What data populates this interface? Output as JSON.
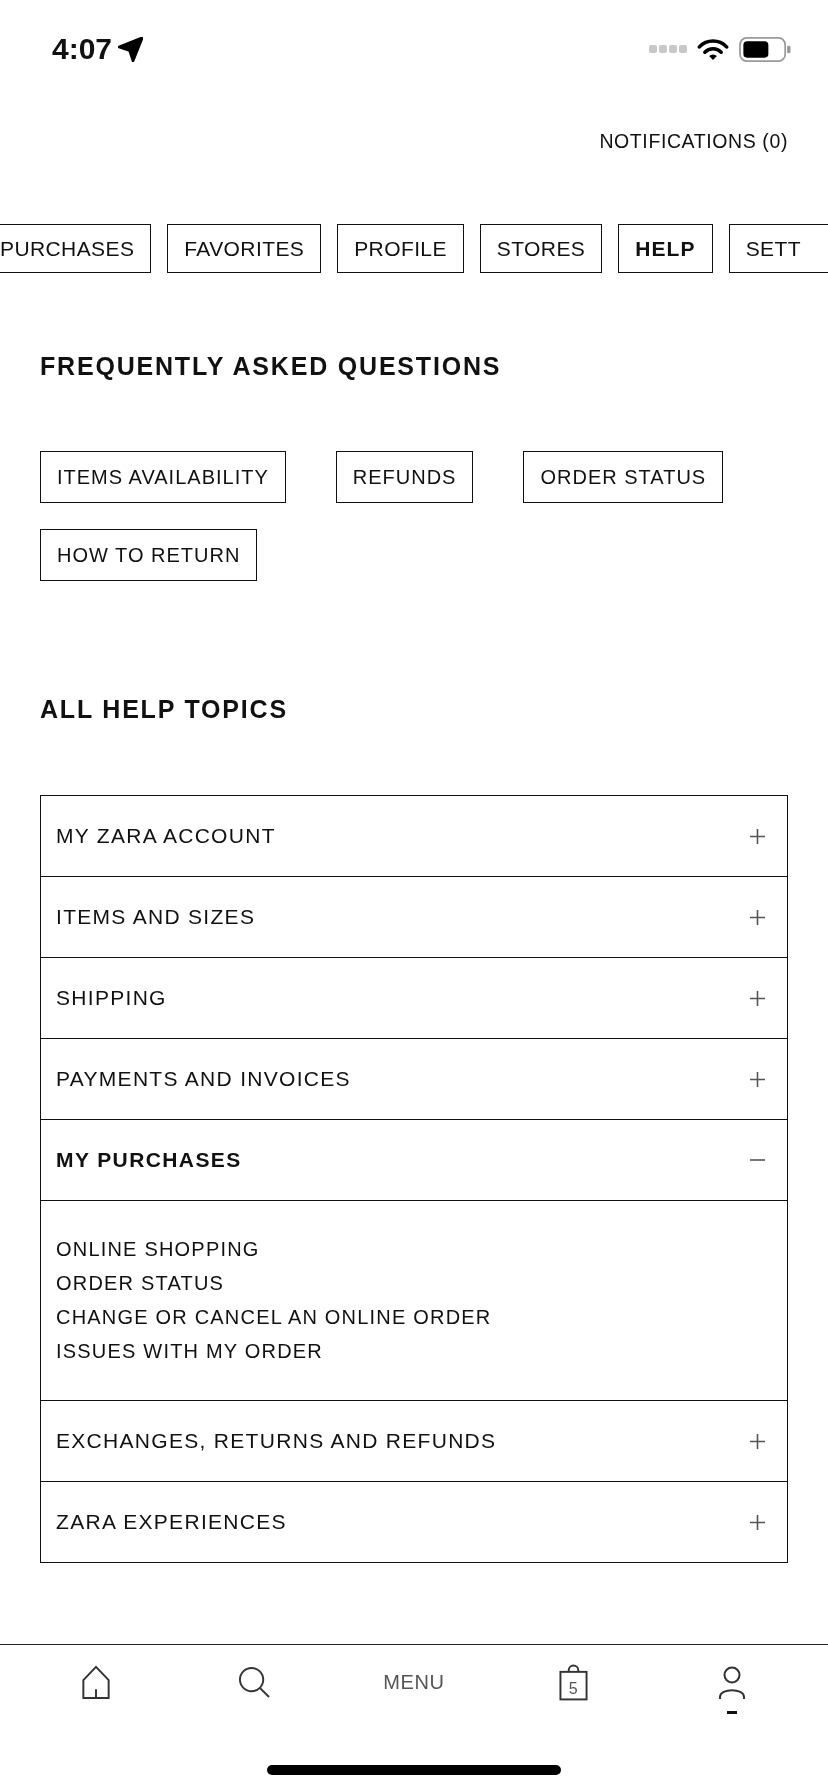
{
  "status_bar": {
    "time": "4:07"
  },
  "header": {
    "notifications": "NOTIFICATIONS (0)"
  },
  "tabs": [
    {
      "label": "PURCHASES",
      "selected": false
    },
    {
      "label": "FAVORITES",
      "selected": false
    },
    {
      "label": "PROFILE",
      "selected": false
    },
    {
      "label": "STORES",
      "selected": false
    },
    {
      "label": "HELP",
      "selected": true
    },
    {
      "label": "SETT",
      "selected": false
    }
  ],
  "faq": {
    "title": "FREQUENTLY ASKED QUESTIONS",
    "shortcuts": [
      "ITEMS AVAILABILITY",
      "REFUNDS",
      "ORDER STATUS",
      "HOW TO RETURN"
    ]
  },
  "topics": {
    "title": "ALL HELP TOPICS",
    "items": [
      {
        "label": "MY ZARA ACCOUNT",
        "expanded": false
      },
      {
        "label": "ITEMS AND SIZES",
        "expanded": false
      },
      {
        "label": "SHIPPING",
        "expanded": false
      },
      {
        "label": "PAYMENTS AND INVOICES",
        "expanded": false
      },
      {
        "label": "MY PURCHASES",
        "expanded": true,
        "links": [
          "ONLINE SHOPPING",
          "ORDER STATUS",
          "CHANGE OR CANCEL AN ONLINE ORDER",
          "ISSUES WITH MY ORDER"
        ]
      },
      {
        "label": "EXCHANGES, RETURNS AND REFUNDS",
        "expanded": false
      },
      {
        "label": "ZARA EXPERIENCES",
        "expanded": false
      }
    ]
  },
  "bottom_nav": [
    {
      "kind": "home",
      "selected": false
    },
    {
      "kind": "search",
      "selected": false
    },
    {
      "kind": "menu",
      "label": "MENU",
      "selected": false
    },
    {
      "kind": "bag",
      "count": "5",
      "selected": false
    },
    {
      "kind": "profile",
      "selected": true
    }
  ]
}
